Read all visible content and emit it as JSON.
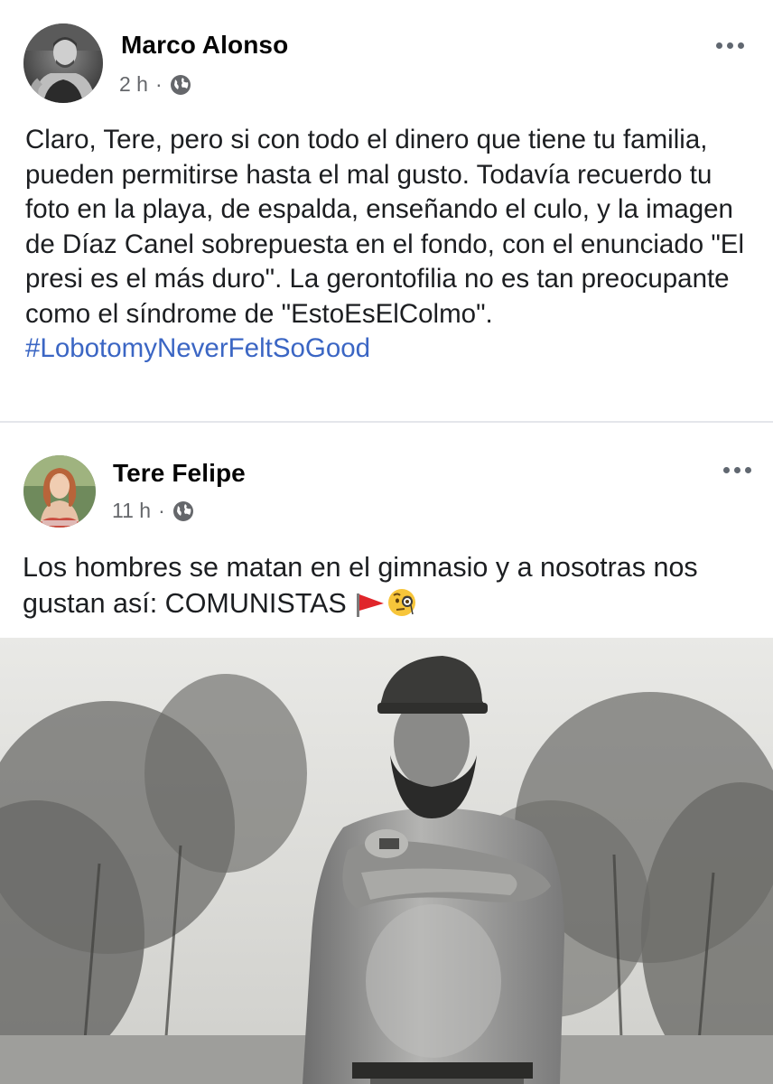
{
  "posts": [
    {
      "author": "Marco Alonso",
      "time": "2 h",
      "separator": "·",
      "privacy_icon": "globe-icon",
      "text": "Claro, Tere, pero si con todo el dinero que tiene tu familia, pueden permitirse hasta el mal gusto. Todavía recuerdo tu foto en la playa, de espalda, enseñando el culo, y la imagen de Díaz Canel sobrepuesta en el fondo, con el enunciado \"El presi es el más duro\". La gerontofilia no es tan preocupante como el síndrome de \"EstoEsElColmo\".",
      "hashtag": "#LobotomyNeverFeltSoGood"
    },
    {
      "author": "Tere Felipe",
      "time": "11 h",
      "separator": "·",
      "privacy_icon": "globe-icon",
      "text": "Los hombres se matan en el gimnasio y a nosotras nos gustan así: COMUNISTAS",
      "emojis": [
        "red-flag-emoji",
        "face-with-monocle-emoji"
      ],
      "photo_description_icon": "black-and-white-photo"
    }
  ],
  "colors": {
    "hashtag": "#3b66c4",
    "meta": "#65676b",
    "text": "#1c1e21",
    "divider": "#e4e6eb"
  }
}
